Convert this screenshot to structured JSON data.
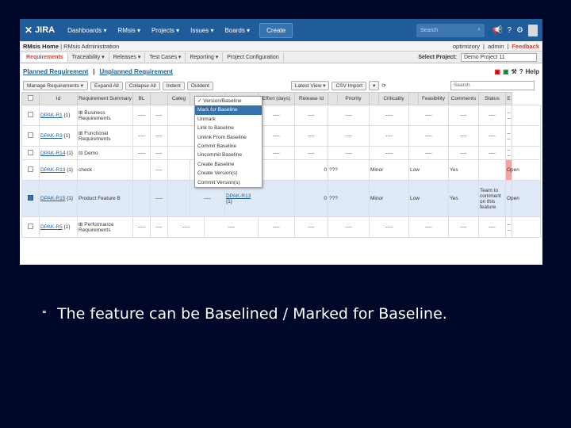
{
  "topbar": {
    "logo": "JIRA",
    "nav": [
      "Dashboards ▾",
      "RMsis ▾",
      "Projects ▾",
      "Issues ▾",
      "Boards ▾"
    ],
    "create": "Create",
    "search": "Search"
  },
  "subbar": {
    "home": "RMsis Home",
    "admin": "RMsis Administration",
    "user": "optimizory",
    "admin_link": "admin",
    "feedback": "Feedback"
  },
  "tabs": [
    "Requirements",
    "Traceability ▾",
    "Releases ▾",
    "Test Cases ▾",
    "Reporting ▾",
    "Project Configuration"
  ],
  "select_project": {
    "label": "Select Project:",
    "value": "Demo Project 11"
  },
  "section": {
    "planned": "Planned Requirement",
    "sep": "|",
    "unplanned": "Unplanned Requirement",
    "help": "Help"
  },
  "toolbar": [
    "Manage Requirements ▾",
    "Expand All",
    "Collapse All",
    "Indent",
    "Outdent"
  ],
  "toolbar2": [
    "Latest View ▾",
    "CSV Import",
    "▾"
  ],
  "table_search": "Search",
  "dropdown": [
    "✓ Version/Baseline Actions",
    "Mark for Baseline",
    "Unmark",
    "Link to Baseline",
    "Unlink From Baseline",
    "Commit Baseline",
    "Uncommit Baseline",
    "Create Baseline",
    "Create Version(s)",
    "Commit Version(s)"
  ],
  "columns": [
    "",
    "Id",
    "Requirement Summary",
    "BL",
    "",
    "Categ",
    "",
    "",
    "ndents",
    "Effort (days)",
    "Release Id",
    "",
    "Priority",
    "",
    "Criticality",
    "",
    "Feasibility",
    "Comments",
    "Status",
    "E"
  ],
  "rows": [
    {
      "id": "DPAK-R1",
      "ver": "{1}",
      "summary": "⊞ Business Requirements",
      "cells": [
        "----",
        "----",
        "",
        "----",
        "----",
        "----",
        "----",
        "----",
        "----",
        "----",
        "----",
        "----"
      ]
    },
    {
      "id": "DPAK-R3",
      "ver": "{1}",
      "summary": "⊞ Functional Requirements",
      "cells": [
        "----",
        "----",
        "",
        "----",
        "----",
        "----",
        "----",
        "----",
        "----",
        "----",
        "----",
        "----"
      ]
    },
    {
      "id": "DPAK-R14",
      "ver": "{1}",
      "summary": "⊟ Demo",
      "cells": [
        "----",
        "----",
        "",
        "----",
        "----",
        "----",
        "----",
        "----",
        "----",
        "----",
        "----",
        "----"
      ]
    },
    {
      "id": "DPAK-R13",
      "ver": "{1}",
      "summary": "check",
      "link": "DPAK-R15",
      "linkver": "{1}",
      "cells": [
        "",
        "----",
        "",
        "----",
        "0",
        "???",
        "Minor",
        "Low",
        "Yes",
        "",
        "Open"
      ]
    },
    {
      "id": "DPAK-R15",
      "ver": "{1}",
      "summary": "Product Feature B",
      "link": "DPAK-R13",
      "linkver": "{1}",
      "cells": [
        "",
        "----",
        "",
        "----",
        "0",
        "???",
        "Minor",
        "Low",
        "Yes",
        "Team to comment on this feature",
        "Open"
      ]
    },
    {
      "id": "DPAK-R5",
      "ver": "{1}",
      "summary": "⊞ Performance Requirements",
      "cells": [
        "----",
        "----",
        "----",
        "----",
        "----",
        "----",
        "----",
        "----",
        "----",
        "----",
        "----",
        "----"
      ]
    }
  ],
  "caption": "The feature can be Baselined / Marked for Baseline.",
  "bullet": ""
}
